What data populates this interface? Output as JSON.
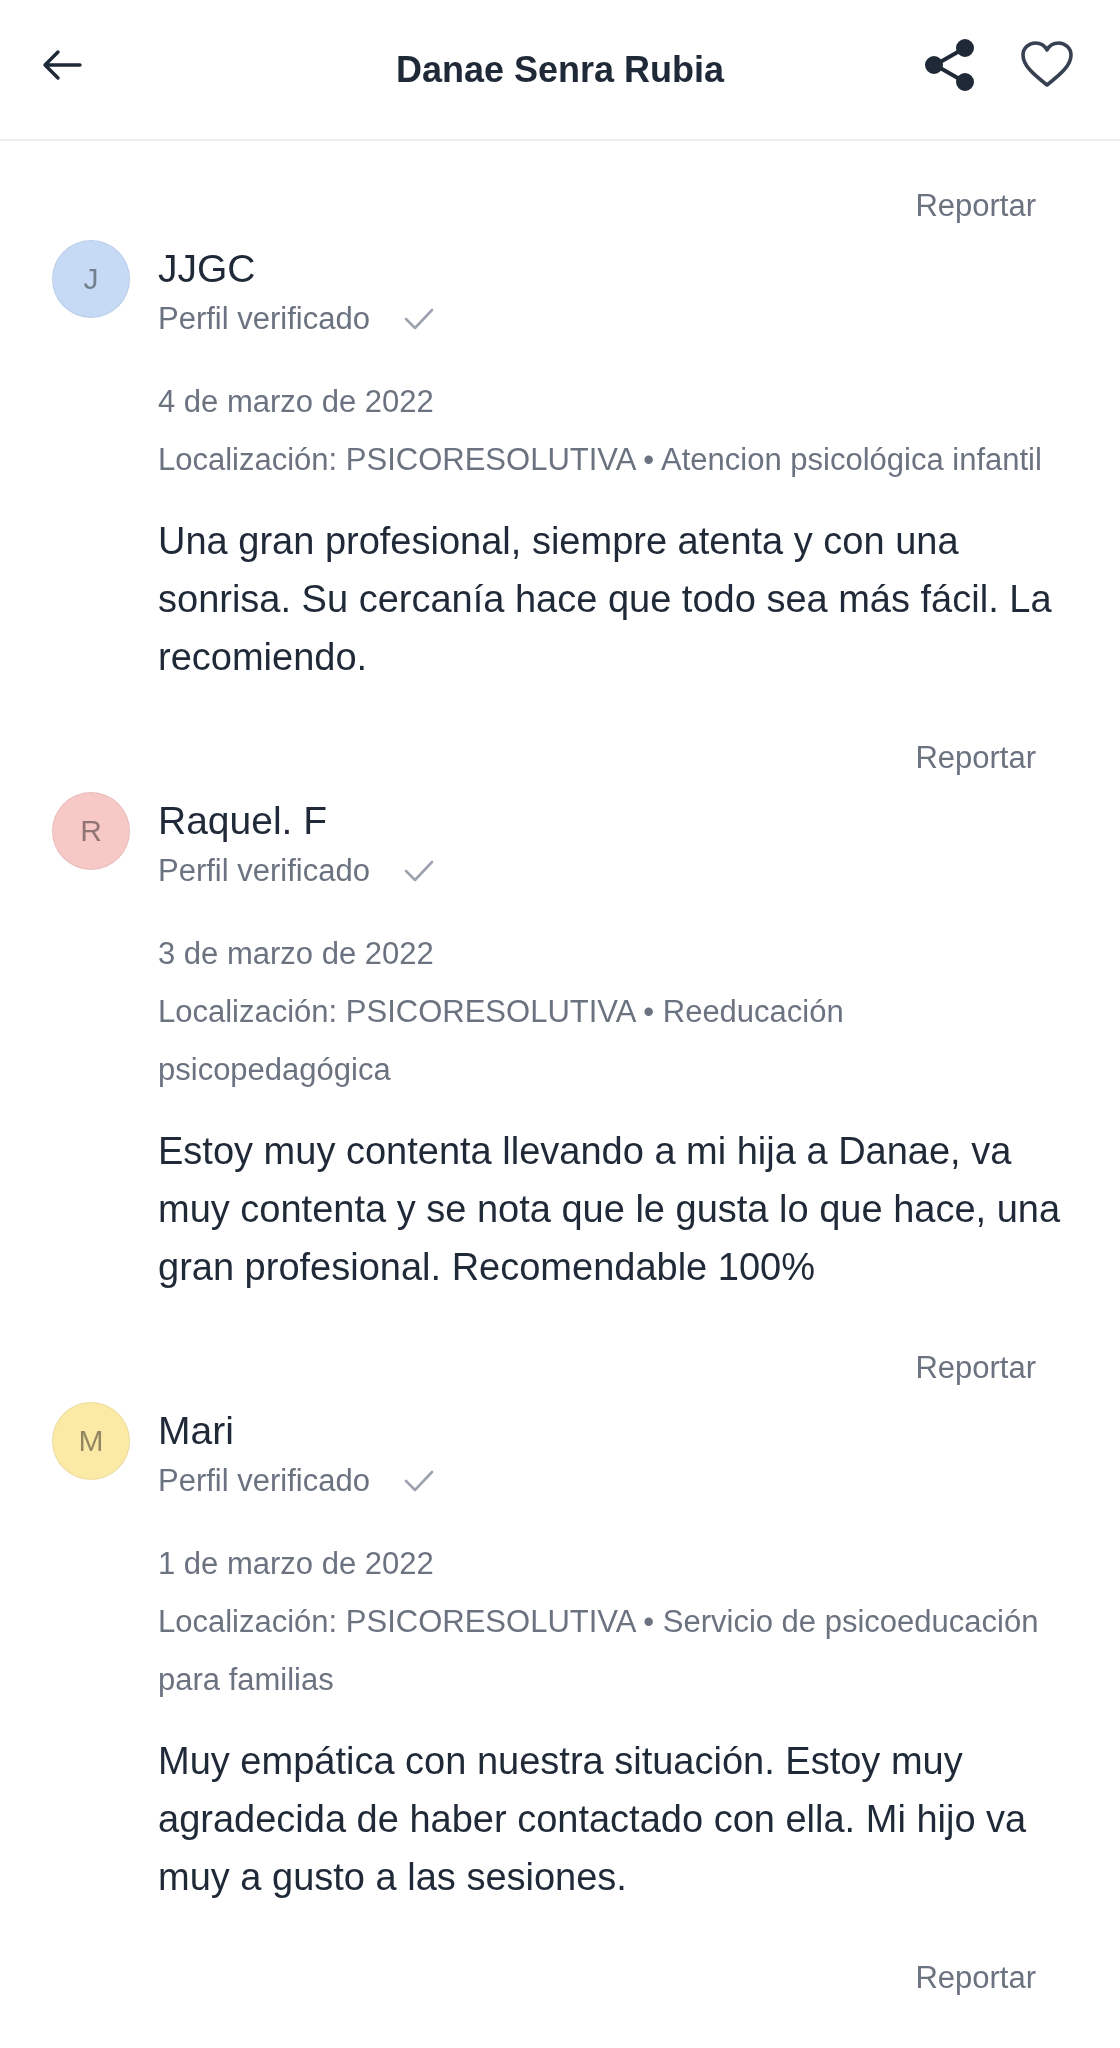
{
  "header": {
    "title": "Danae Senra Rubia"
  },
  "reviews": [
    {
      "report": "Reportar",
      "initial": "J",
      "color": "#c6daf6",
      "name": "JJGC",
      "verified": "Perfil verificado",
      "date": "4 de marzo de 2022",
      "location": "Localización: PSICORESOLUTIVA • Atencion psicológica infantil",
      "text": "Una gran profesional, siempre atenta y con una sonrisa. Su cercanía hace que todo sea más fácil. La recomiendo."
    },
    {
      "report": "Reportar",
      "initial": "R",
      "color": "#f6c8c6",
      "name": "Raquel. F",
      "verified": "Perfil verificado",
      "date": "3 de marzo de 2022",
      "location": "Localización: PSICORESOLUTIVA • Reeducación psicopedagógica",
      "text": "Estoy muy contenta llevando a mi hija a Danae, va muy contenta y se nota que le gusta lo que hace, una gran profesional. Recomendable 100%"
    },
    {
      "report": "Reportar",
      "initial": "M",
      "color": "#fbe9a6",
      "name": "Mari",
      "verified": "Perfil verificado",
      "date": "1 de marzo de 2022",
      "location": "Localización: PSICORESOLUTIVA • Servicio de psicoeducación para familias",
      "text": "Muy empática con nuestra situación. Estoy muy agradecida de haber contactado con ella. Mi hijo va muy a gusto a las sesiones."
    }
  ],
  "next_review": {
    "report": "Reportar"
  }
}
